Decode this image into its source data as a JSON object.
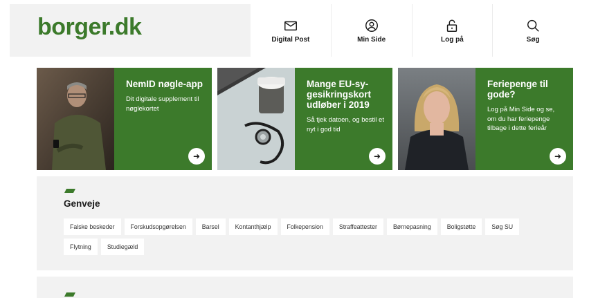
{
  "logo": "borger.dk",
  "nav": [
    {
      "label": "Digital Post",
      "icon": "envelope-icon"
    },
    {
      "label": "Min Side",
      "icon": "user-icon"
    },
    {
      "label": "Log på",
      "icon": "lock-icon"
    },
    {
      "label": "Søg",
      "icon": "search-icon"
    }
  ],
  "cards": [
    {
      "title": "NemID nøgle-app",
      "text": "Dit digitale supplement til nøglekortet"
    },
    {
      "title": "Mange EU-sy-gesikringskort udløber i 2019",
      "text": "Så tjek datoen, og bestil et nyt i god tid"
    },
    {
      "title": "Feriepenge til gode?",
      "text": "Log på Min Side og se, om du har feriepenge tilbage i dette ferieår"
    }
  ],
  "genveje": {
    "title": "Genveje",
    "links": [
      "Falske beskeder",
      "Forskudsopgørelsen",
      "Barsel",
      "Kontanthjælp",
      "Folkepension",
      "Straffeattester",
      "Børnepasning",
      "Boligstøtte",
      "Søg SU",
      "Flytning",
      "Studiegæld"
    ]
  },
  "colors": {
    "brand_green": "#3c7a2b",
    "panel_grey": "#f2f2f2"
  }
}
